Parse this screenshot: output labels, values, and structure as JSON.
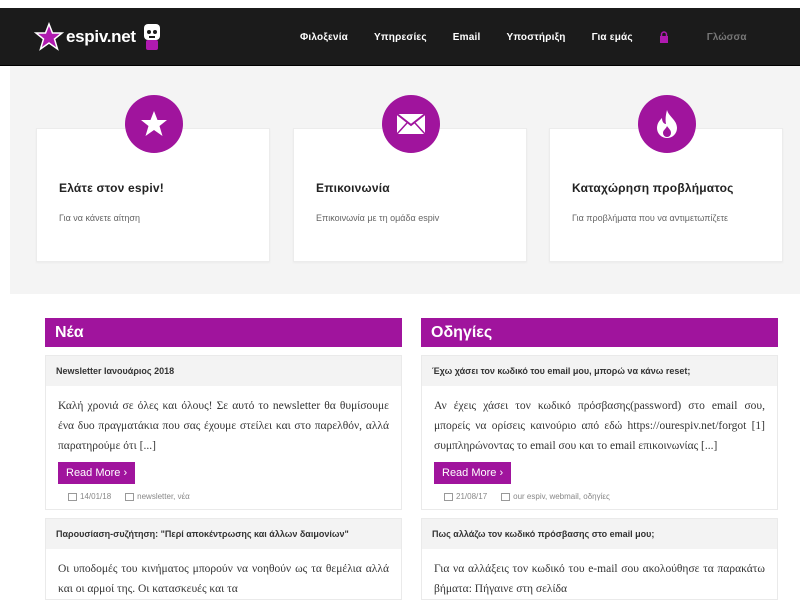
{
  "header": {
    "brand": "espiv.net",
    "nav": [
      "Φιλοξενία",
      "Υπηρεσίες",
      "Email",
      "Υποστήριξη",
      "Για εμάς"
    ],
    "language": "Γλώσσα"
  },
  "features": [
    {
      "title": "Ελάτε στον espiv!",
      "text": "Για να κάνετε αίτηση",
      "icon": "star-icon"
    },
    {
      "title": "Επικοινωνία",
      "text": "Επικοινωνία με τη ομάδα espiv",
      "icon": "envelope-icon"
    },
    {
      "title": "Καταχώρηση προβλήματος",
      "text": "Για προβλήματα που να αντιμετωπίζετε",
      "icon": "flame-icon"
    }
  ],
  "news": {
    "header": "Νέα",
    "posts": [
      {
        "title": "Newsletter Ιανουάριος 2018",
        "body": "Καλή χρονιά σε όλες και όλους! Σε αυτό το newsletter θα θυμίσουμε ένα δυο πραγματάκια που σας έχουμε στείλει και στο παρελθόν, αλλά παρατηρούμε ότι [...]",
        "read_more": "Read More ›",
        "date": "14/01/18",
        "tags": "newsletter, νέα"
      },
      {
        "title": "Παρουσίαση-συζήτηση: \"Περί αποκέντρωσης και άλλων δαιμονίων\"",
        "body": "Οι υποδομές του κινήματος μπορούν να νοηθούν ως τα θεμέλια αλλά και οι αρμοί της. Οι κατασκευές και τα"
      }
    ]
  },
  "guides": {
    "header": "Οδηγίες",
    "posts": [
      {
        "title": "Έχω χάσει τον κωδικό του email μου, μπορώ να κάνω reset;",
        "body": "Αν έχεις χάσει τον κωδικό πρόσβασης(password) στο email σου, μπορείς να ορίσεις καινούριο από εδώ https://ourespiv.net/forgot [1] συμπληρώνοντας το email σου και το email επικοινωνίας [...]",
        "read_more": "Read More ›",
        "date": "21/08/17",
        "tags": "our espiv, webmail, οδηγίες"
      },
      {
        "title": "Πως αλλάζω τον κωδικό πρόσβασης στο email μου;",
        "body": "Για να αλλάξεις τον κωδικό του e-mail σου ακολούθησε τα παρακάτω βήματα: Πήγαινε στη σελίδα"
      }
    ]
  },
  "colors": {
    "accent": "#a0149d",
    "navbar": "#1b1b1b"
  }
}
